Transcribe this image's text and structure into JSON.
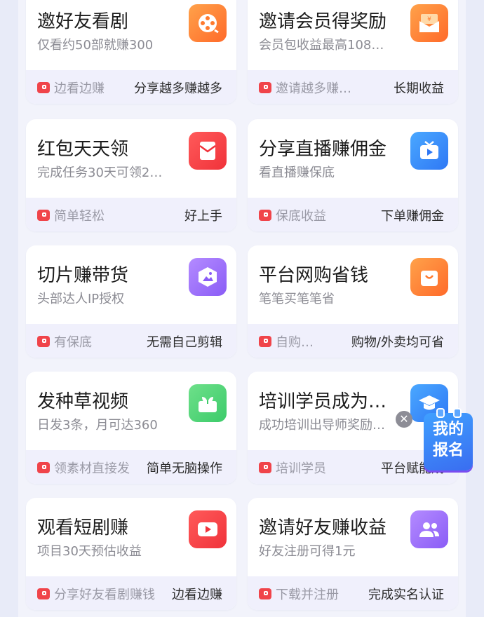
{
  "cards": [
    {
      "title": "邀好友看剧",
      "subtitle": "仅看约50部就赚300",
      "tag": "边看边赚",
      "right": "分享越多赚越多",
      "icon": "film-reel-icon",
      "color": "orange"
    },
    {
      "title": "邀请会员得奖励",
      "subtitle": "会员包收益最高108…",
      "tag": "邀请越多赚越多",
      "right": "长期收益",
      "icon": "yen-envelope-icon",
      "color": "orange"
    },
    {
      "title": "红包天天领",
      "subtitle": "完成任务30天可领2…",
      "tag": "简单轻松",
      "right": "好上手",
      "icon": "red-envelope-icon",
      "color": "red"
    },
    {
      "title": "分享直播赚佣金",
      "subtitle": "看直播赚保底",
      "tag": "保底收益",
      "right": "下单赚佣金",
      "icon": "tv-play-icon",
      "color": "blue"
    },
    {
      "title": "切片赚带货",
      "subtitle": "头部达人IP授权",
      "tag": "有保底",
      "right": "无需自己剪辑",
      "icon": "image-hexagon-icon",
      "color": "purple"
    },
    {
      "title": "平台网购省钱",
      "subtitle": "笔笔买笔笔省",
      "tag": "自购省…",
      "right": "购物/外卖均可省",
      "icon": "shopping-bag-icon",
      "color": "orange"
    },
    {
      "title": "发种草视频",
      "subtitle": "日发3条，月可达360",
      "tag": "领素材直接发",
      "right": "简单无脑操作",
      "icon": "sprout-icon",
      "color": "green"
    },
    {
      "title": "培训学员成为…",
      "subtitle": "成功培训出导师奖励…",
      "tag": "培训学员",
      "right": "平台赋能成",
      "icon": "graduation-cap-icon",
      "color": "blue"
    },
    {
      "title": "观看短剧赚",
      "subtitle": "项目30天预估收益",
      "tag": "分享好友看剧赚钱",
      "right": "边看边赚",
      "icon": "play-button-icon",
      "color": "red"
    },
    {
      "title": "邀请好友赚收益",
      "subtitle": "好友注册可得1元",
      "tag": "下载并注册",
      "right": "完成实名认证",
      "icon": "users-icon",
      "color": "purple"
    }
  ],
  "floating_badge": {
    "line1": "我的",
    "line2": "报名"
  },
  "close_glyph": "✕"
}
